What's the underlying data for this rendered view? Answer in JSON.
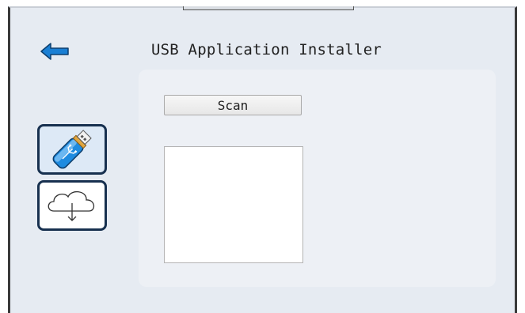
{
  "header": {
    "title": "USB Application Installer",
    "back_icon": "back-arrow-icon"
  },
  "sidebar": {
    "items": [
      {
        "name": "usb",
        "icon": "usb-drive-icon",
        "selected": true
      },
      {
        "name": "cloud",
        "icon": "cloud-download-icon",
        "selected": false
      }
    ]
  },
  "main": {
    "scan_label": "Scan",
    "app_list": []
  },
  "colors": {
    "background": "#e6ebf2",
    "panel": "#edf0f5",
    "accent": "#1a7fd4",
    "border": "#17304f"
  }
}
